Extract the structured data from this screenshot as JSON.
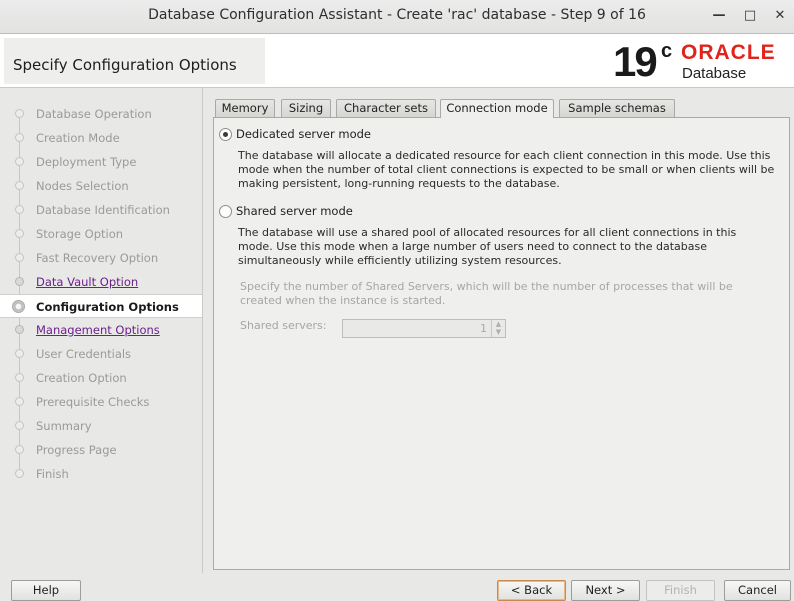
{
  "window": {
    "title": "Database Configuration Assistant - Create 'rac' database - Step 9 of 16",
    "min_glyph": "—",
    "max_glyph": "□",
    "close_glyph": "✕"
  },
  "header": {
    "step_title": "Specify Configuration Options",
    "logo": {
      "version": "19",
      "version_sup": "c",
      "brand": "ORACLE",
      "product": "Database",
      "brand_color": "#e0241b"
    }
  },
  "sidebar": {
    "steps": [
      {
        "label": "Database Operation",
        "state": "done"
      },
      {
        "label": "Creation Mode",
        "state": "done"
      },
      {
        "label": "Deployment Type",
        "state": "done"
      },
      {
        "label": "Nodes Selection",
        "state": "done"
      },
      {
        "label": "Database Identification",
        "state": "done"
      },
      {
        "label": "Storage Option",
        "state": "done"
      },
      {
        "label": "Fast Recovery Option",
        "state": "done"
      },
      {
        "label": "Data Vault Option",
        "state": "link"
      },
      {
        "label": "Configuration Options",
        "state": "current"
      },
      {
        "label": "Management Options",
        "state": "link"
      },
      {
        "label": "User Credentials",
        "state": "pending"
      },
      {
        "label": "Creation Option",
        "state": "pending"
      },
      {
        "label": "Prerequisite Checks",
        "state": "pending"
      },
      {
        "label": "Summary",
        "state": "pending"
      },
      {
        "label": "Progress Page",
        "state": "pending"
      },
      {
        "label": "Finish",
        "state": "pending"
      }
    ]
  },
  "tabs": [
    {
      "label": "Memory"
    },
    {
      "label": "Sizing"
    },
    {
      "label": "Character sets"
    },
    {
      "label": "Connection mode",
      "active": true
    },
    {
      "label": "Sample schemas"
    }
  ],
  "connection_mode": {
    "dedicated": {
      "label": "Dedicated server mode",
      "selected": true,
      "description": "The database will allocate a dedicated resource for each client connection in this mode. Use this mode when the number of total client connections is expected to be small or when clients will be making persistent, long-running requests to the database."
    },
    "shared": {
      "label": "Shared server mode",
      "selected": false,
      "description": "The database will use a shared pool of allocated resources for all client connections in this mode.  Use this mode when a large number of users need to connect to the database simultaneously while efficiently utilizing system resources."
    },
    "shared_servers_hint": "Specify the number of Shared Servers, which will be the number of processes that will be created when the instance is started.",
    "shared_servers_label": "Shared servers:",
    "shared_servers_value": "1"
  },
  "buttons": {
    "help": "Help",
    "back": "< Back",
    "next": "Next >",
    "finish": "Finish",
    "cancel": "Cancel"
  }
}
